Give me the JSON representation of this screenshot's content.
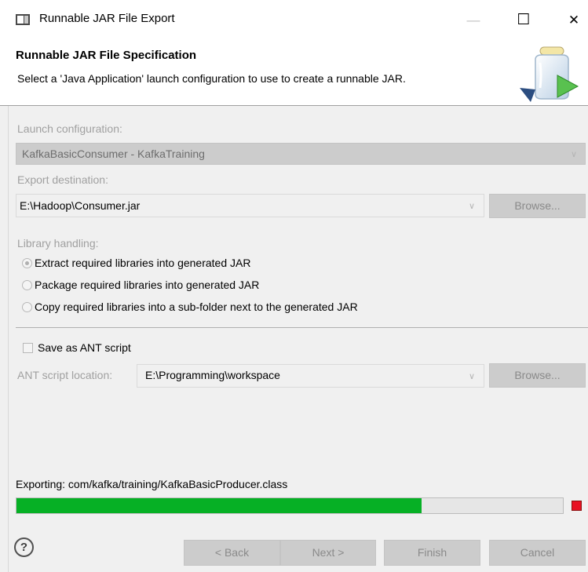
{
  "window": {
    "title": "Runnable JAR File Export",
    "minimize_glyph": "—",
    "maximize_glyph": "☐",
    "close_glyph": "✕"
  },
  "header": {
    "title": "Runnable JAR File Specification",
    "description": "Select a 'Java Application' launch configuration to use to create a runnable JAR."
  },
  "launch": {
    "label": "Launch configuration:",
    "value": "KafkaBasicConsumer - KafkaTraining"
  },
  "export": {
    "label": "Export destination:",
    "value": "E:\\Hadoop\\Consumer.jar",
    "browse_label": "Browse..."
  },
  "library": {
    "label": "Library handling:",
    "options": [
      {
        "label": "Extract required libraries into generated JAR",
        "selected": true
      },
      {
        "label": "Package required libraries into generated JAR",
        "selected": false
      },
      {
        "label": "Copy required libraries into a sub-folder next to the generated JAR",
        "selected": false
      }
    ]
  },
  "ant": {
    "save_label": "Save as ANT script",
    "checked": false,
    "location_label": "ANT script location:",
    "location_value": "E:\\Programming\\workspace",
    "browse_label": "Browse..."
  },
  "progress": {
    "status_text": "Exporting: com/kafka/training/KafkaBasicProducer.class",
    "fraction": 0.742,
    "bar_color": "#06b025"
  },
  "footer": {
    "help_label": "?",
    "back_label": "< Back",
    "next_label": "Next >",
    "finish_label": "Finish",
    "cancel_label": "Cancel"
  },
  "icons": {
    "app": "jar-file-icon",
    "banner": "jar-export-icon",
    "dropdown": "chevron-down-icon",
    "help": "help-icon",
    "stop": "stop-icon"
  }
}
